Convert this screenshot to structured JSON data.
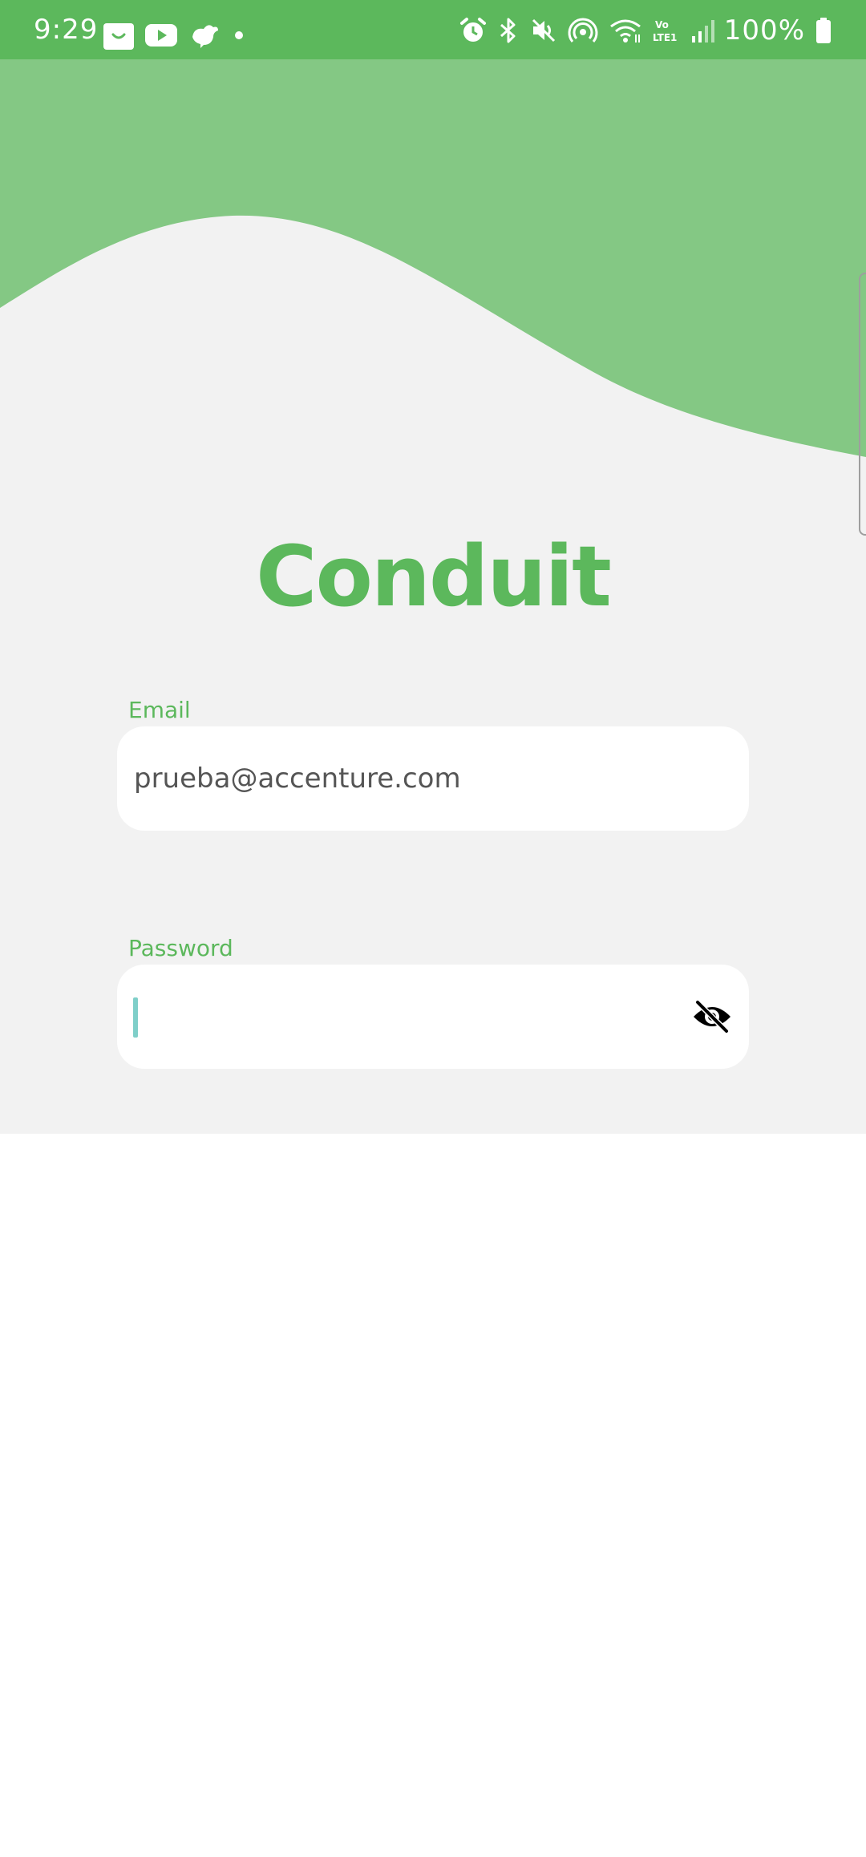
{
  "status_bar": {
    "time": "9:29",
    "battery": "100%",
    "left_icons": [
      "bag-icon",
      "youtube-icon",
      "bird-icon",
      "dot-icon"
    ],
    "right_icons": [
      "alarm-icon",
      "bluetooth-icon",
      "mute-icon",
      "hotspot-icon",
      "wifi-icon",
      "volte-icon",
      "signal-icon",
      "battery-icon"
    ],
    "volte_top": "Vo",
    "volte_bottom": "LTE1"
  },
  "app": {
    "title": "Conduit",
    "brand_color": "#5cb85c",
    "wave_color": "#84c884"
  },
  "form": {
    "email": {
      "label": "Email",
      "value": "prueba@accenture.com"
    },
    "password": {
      "label": "Password",
      "value": "",
      "toggle_icon": "eye-off-icon"
    }
  }
}
